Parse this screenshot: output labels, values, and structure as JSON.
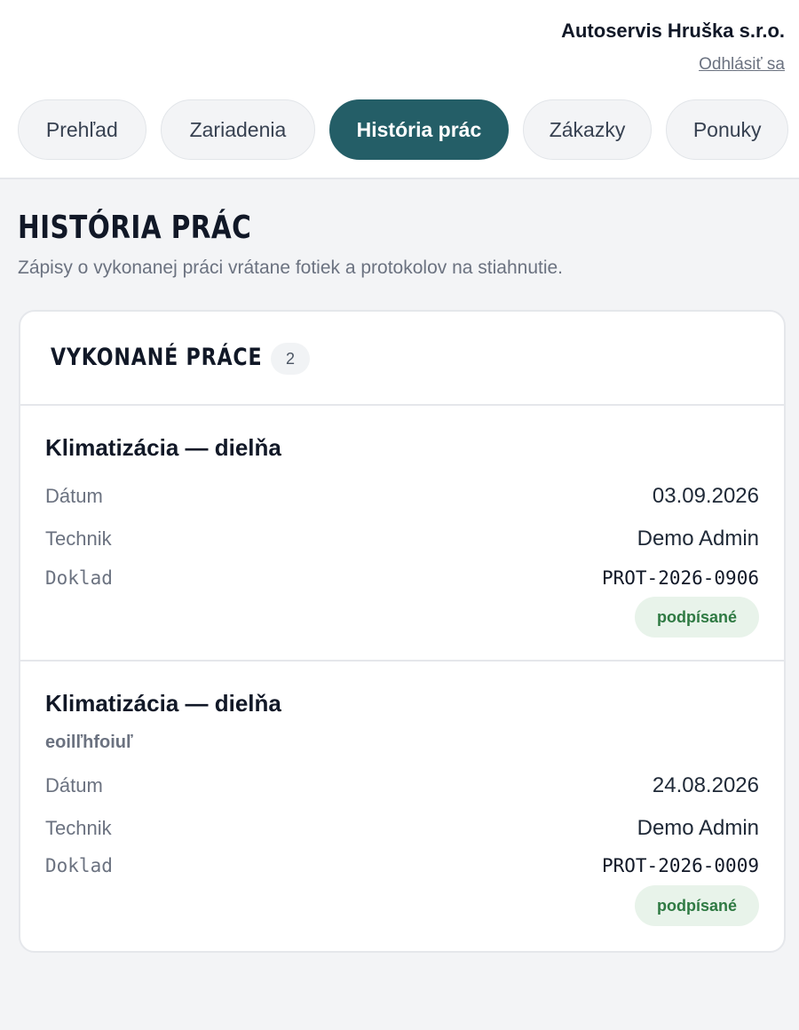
{
  "header": {
    "company": "Autoservis Hruška s.r.o.",
    "logout": "Odhlásiť sa"
  },
  "nav": {
    "tabs": [
      {
        "label": "Prehľad",
        "active": false
      },
      {
        "label": "Zariadenia",
        "active": false
      },
      {
        "label": "História prác",
        "active": true
      },
      {
        "label": "Zákazky",
        "active": false
      },
      {
        "label": "Ponuky",
        "active": false
      }
    ]
  },
  "page": {
    "title": "HISTÓRIA PRÁC",
    "subtitle": "Zápisy o vykonanej práci vrátane fotiek a protokolov na stiahnutie."
  },
  "card": {
    "title": "VYKONANÉ PRÁCE",
    "count": "2",
    "entries": [
      {
        "title": "Klimatizácia — dielňa",
        "note": "",
        "date_label": "Dátum",
        "date": "03.09.2026",
        "technician_label": "Technik",
        "technician": "Demo Admin",
        "document_label": "Doklad",
        "document": "PROT-2026-0906",
        "status": "podpísané"
      },
      {
        "title": "Klimatizácia — dielňa",
        "note": "eoilľhfoiuľ",
        "date_label": "Dátum",
        "date": "24.08.2026",
        "technician_label": "Technik",
        "technician": "Demo Admin",
        "document_label": "Doklad",
        "document": "PROT-2026-0009",
        "status": "podpísané"
      }
    ]
  },
  "colors": {
    "accent": "#245e67",
    "status_bg": "#e8f3ea",
    "status_text": "#2f7a43",
    "page_bg": "#f3f4f6"
  }
}
